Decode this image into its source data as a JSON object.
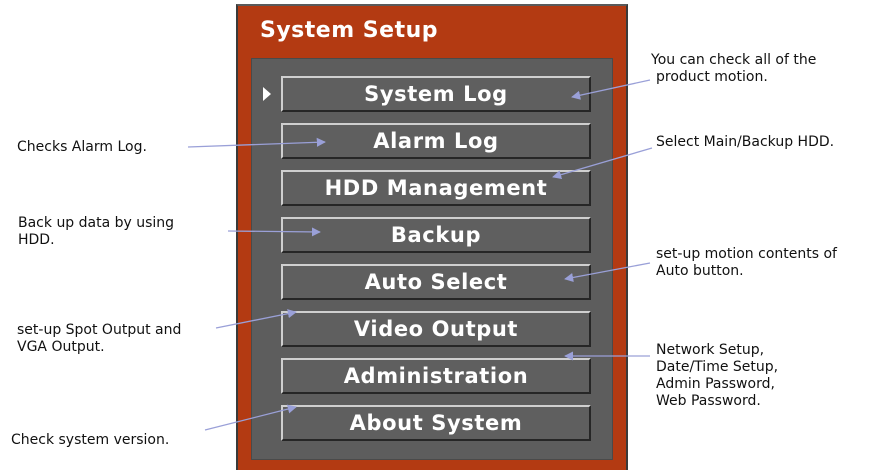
{
  "osd": {
    "title": "System Setup",
    "frame_color": "#b33a12",
    "panel_color": "#5d5d5d",
    "menu_items": [
      {
        "label": "System Log",
        "selected": true
      },
      {
        "label": "Alarm Log"
      },
      {
        "label": "HDD Management"
      },
      {
        "label": "Backup"
      },
      {
        "label": "Auto Select"
      },
      {
        "label": "Video Output"
      },
      {
        "label": "Administration"
      },
      {
        "label": "About System"
      }
    ]
  },
  "callouts": {
    "system_log": [
      "You can check all of the",
      "product motion."
    ],
    "alarm_log": [
      "Checks Alarm Log."
    ],
    "hdd_management": [
      "Select Main/Backup HDD."
    ],
    "backup": [
      "Back up data by using",
      "HDD."
    ],
    "auto_select": [
      "set-up motion contents of",
      "Auto button."
    ],
    "video_output": [
      "set-up Spot Output and",
      "VGA Output."
    ],
    "administration": [
      "Network Setup,",
      "Date/Time Setup,",
      "Admin Password,",
      "Web Password."
    ],
    "about_system": [
      "Check system version."
    ]
  },
  "arrow_color": "#9aa0d8"
}
